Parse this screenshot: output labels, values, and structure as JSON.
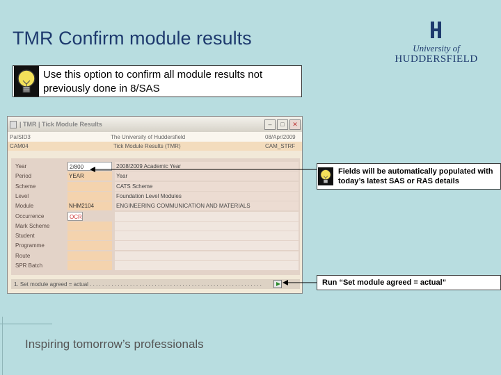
{
  "slide": {
    "title": "TMR Confirm module results",
    "tagline": "Inspiring tomorrow’s professionals"
  },
  "logo": {
    "line1": "University of",
    "line2": "HUDDERSFIELD"
  },
  "tips": {
    "main": "Use this option to confirm all module results not previously done in 8/SAS",
    "fields": "Fields will be automatically populated with today’s latest SAS or RAS details",
    "run": "Run “Set module agreed = actual”"
  },
  "app": {
    "window_title": "| TMR | Tick Module Results",
    "header_row1": {
      "left": "PaISID3",
      "center": "The University of Huddersfield",
      "right": "08/Apr/2009"
    },
    "header_row2": {
      "left": "CAM04",
      "center": "Tick Module Results (TMR)",
      "right": "CAM_STRF"
    },
    "fields": [
      {
        "label": "Year",
        "code": "2/800",
        "desc": "2008/2009 Academic Year"
      },
      {
        "label": "Period",
        "code": "YEAR",
        "desc": "Year"
      },
      {
        "label": "Scheme",
        "code": "",
        "desc": "CATS Scheme"
      },
      {
        "label": "Level",
        "code": "",
        "desc": "Foundation Level Modules"
      },
      {
        "label": "Module",
        "code": "NHM2104",
        "desc": "ENGINEERING COMMUNICATION AND MATERIALS"
      },
      {
        "label": "Occurrence",
        "code": "OCR",
        "desc": ""
      },
      {
        "label": "Mark Scheme",
        "code": "",
        "desc": ""
      },
      {
        "label": "Student",
        "code": "",
        "desc": ""
      },
      {
        "label": "Programme",
        "code": "",
        "desc": ""
      },
      {
        "label": "Route",
        "code": "",
        "desc": ""
      },
      {
        "label": "SPR Batch",
        "code": "",
        "desc": ""
      }
    ],
    "action": "1. Set module agreed = actual . . . . . . . . . . . . . . . . . . . . . . . . . . . . . . . . . . . . . . . . . . . . . . . . . . . . . . . ."
  },
  "colors": {
    "background": "#b8dde0",
    "title": "#1e3a6e",
    "occurrence_red": "#cc3333"
  },
  "icons": [
    "lightbulb-icon",
    "app-icon",
    "minimize-icon",
    "maximize-icon",
    "close-icon",
    "run-icon",
    "university-logo-icon"
  ]
}
